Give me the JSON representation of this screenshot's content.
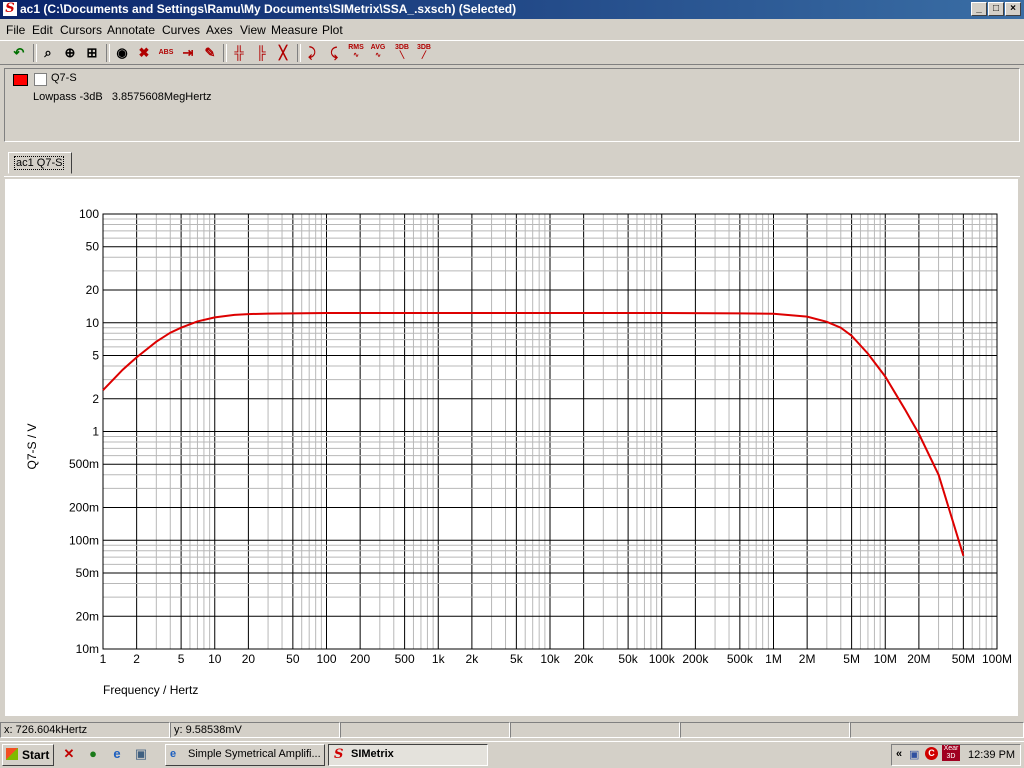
{
  "window": {
    "title": "ac1 (C:\\Documents and Settings\\Ramu\\My Documents\\SIMetrix\\SSA_.sxsch) (Selected)",
    "controls": [
      "_",
      "□",
      "×"
    ]
  },
  "menu": [
    "File",
    "Edit",
    "Cursors",
    "Annotate",
    "Curves",
    "Axes",
    "View",
    "Measure",
    "Plot"
  ],
  "toolbar": {
    "labels": {
      "abs": "ABS",
      "rms": "RMS",
      "avg": "AVG",
      "db3a": "3DB",
      "db3b": "3DB"
    }
  },
  "legend": {
    "curve_name": "Q7-S",
    "curve_color": "#ff0000",
    "measurement": "Lowpass -3dB   3.8575608MegHertz"
  },
  "tab": {
    "label": "ac1 Q7-S"
  },
  "chart_data": {
    "type": "line",
    "xscale": "log",
    "yscale": "log",
    "xlim": [
      1,
      100000000
    ],
    "ylim": [
      0.01,
      100
    ],
    "xlabel": "Frequency / Hertz",
    "ylabel": "Q7-S / V",
    "grid": true,
    "x_ticks": [
      {
        "value": 1,
        "label": "1"
      },
      {
        "value": 2,
        "label": "2"
      },
      {
        "value": 5,
        "label": "5"
      },
      {
        "value": 10,
        "label": "10"
      },
      {
        "value": 20,
        "label": "20"
      },
      {
        "value": 50,
        "label": "50"
      },
      {
        "value": 100,
        "label": "100"
      },
      {
        "value": 200,
        "label": "200"
      },
      {
        "value": 500,
        "label": "500"
      },
      {
        "value": 1000,
        "label": "1k"
      },
      {
        "value": 2000,
        "label": "2k"
      },
      {
        "value": 5000,
        "label": "5k"
      },
      {
        "value": 10000,
        "label": "10k"
      },
      {
        "value": 20000,
        "label": "20k"
      },
      {
        "value": 50000,
        "label": "50k"
      },
      {
        "value": 100000,
        "label": "100k"
      },
      {
        "value": 200000,
        "label": "200k"
      },
      {
        "value": 500000,
        "label": "500k"
      },
      {
        "value": 1000000,
        "label": "1M"
      },
      {
        "value": 2000000,
        "label": "2M"
      },
      {
        "value": 5000000,
        "label": "5M"
      },
      {
        "value": 10000000,
        "label": "10M"
      },
      {
        "value": 20000000,
        "label": "20M"
      },
      {
        "value": 50000000,
        "label": "50M"
      },
      {
        "value": 100000000,
        "label": "100M"
      }
    ],
    "y_ticks": [
      {
        "value": 0.01,
        "label": "10m"
      },
      {
        "value": 0.02,
        "label": "20m"
      },
      {
        "value": 0.05,
        "label": "50m"
      },
      {
        "value": 0.1,
        "label": "100m"
      },
      {
        "value": 0.2,
        "label": "200m"
      },
      {
        "value": 0.5,
        "label": "500m"
      },
      {
        "value": 1,
        "label": "1"
      },
      {
        "value": 2,
        "label": "2"
      },
      {
        "value": 5,
        "label": "5"
      },
      {
        "value": 10,
        "label": "10"
      },
      {
        "value": 20,
        "label": "20"
      },
      {
        "value": 50,
        "label": "50"
      },
      {
        "value": 100,
        "label": "100"
      }
    ],
    "series": [
      {
        "name": "Q7-S",
        "color": "#dd0000",
        "x": [
          1,
          1.5,
          2,
          3,
          4,
          5,
          7,
          10,
          15,
          20,
          30,
          50,
          100,
          1000,
          10000,
          100000,
          500000,
          1000000,
          2000000,
          3000000,
          4000000,
          5000000,
          7000000,
          10000000,
          15000000,
          20000000,
          30000000,
          50000000
        ],
        "y": [
          2.4,
          3.7,
          4.8,
          6.7,
          8.1,
          9.0,
          10.3,
          11.2,
          11.8,
          12.0,
          12.15,
          12.2,
          12.3,
          12.3,
          12.3,
          12.3,
          12.2,
          12.1,
          11.4,
          10.2,
          9.0,
          7.6,
          5.2,
          3.2,
          1.6,
          0.95,
          0.4,
          0.072
        ]
      }
    ]
  },
  "status": {
    "x_readout": "x: 726.604kHertz",
    "y_readout": "y: 9.58538mV"
  },
  "taskbar": {
    "start_label": "Start",
    "tasks": [
      "Simple Symetrical Amplifi...",
      "SIMetrix"
    ],
    "tray_label": "Xear 3D",
    "clock": "12:39 PM"
  }
}
